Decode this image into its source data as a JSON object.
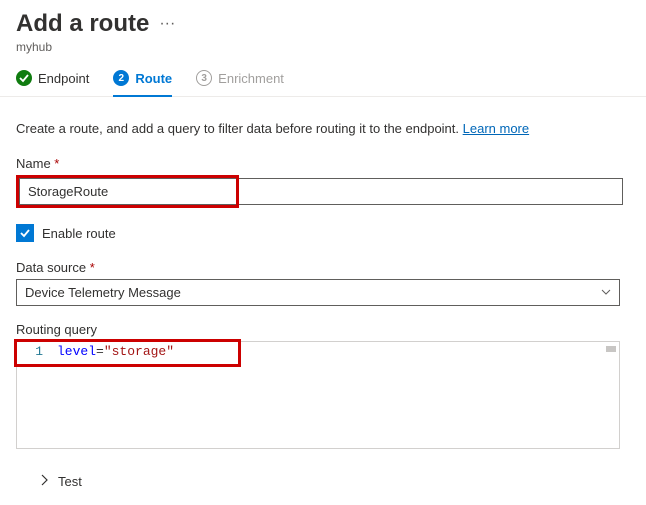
{
  "header": {
    "title": "Add a route",
    "subtitle": "myhub"
  },
  "wizard": {
    "steps": [
      {
        "label": "Endpoint",
        "icon": "check"
      },
      {
        "label": "Route",
        "icon": "2"
      },
      {
        "label": "Enrichment",
        "icon": "3"
      }
    ]
  },
  "intro": {
    "text": "Create a route, and add a query to filter data before routing it to the endpoint. ",
    "learn_more": "Learn more"
  },
  "fields": {
    "name_label": "Name ",
    "name_value": "StorageRoute",
    "enable_label": "Enable route",
    "data_source_label": "Data source ",
    "data_source_value": "Device Telemetry Message",
    "routing_query_label": "Routing query",
    "query_line_num": "1",
    "query_kw": "level",
    "query_op": "=",
    "query_str": "\"storage\""
  },
  "test": {
    "label": "Test"
  }
}
